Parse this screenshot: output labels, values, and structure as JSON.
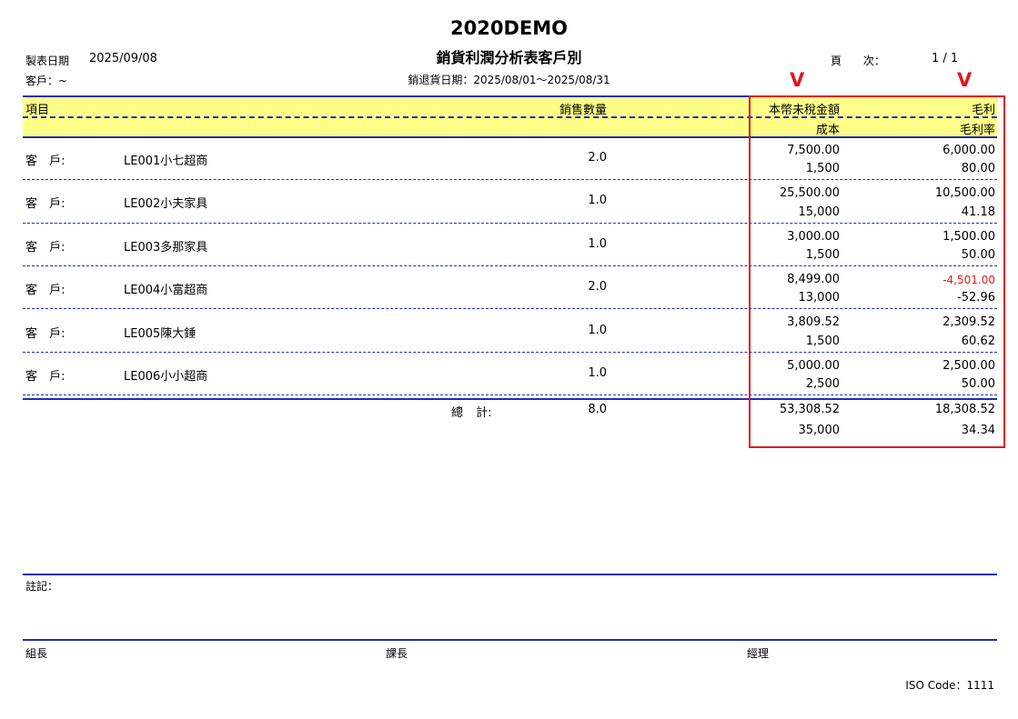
{
  "header": {
    "company": "2020DEMO",
    "report_title": "銷貨利潤分析表客戶別",
    "print_date_label": "製表日期",
    "print_date": "2025/09/08",
    "customer_filter": "客戶：~",
    "period": "銷退貨日期：2025/08/01～2025/08/31",
    "page_label": "頁 次：",
    "page_number": "1 / 1"
  },
  "columns": {
    "item": "項目",
    "qty": "銷售數量",
    "amount": "本幣未稅金額",
    "profit": "毛利",
    "cost": "成本",
    "margin": "毛利率"
  },
  "rows": [
    {
      "label": "客 戶:",
      "name": "LE001小七超商",
      "qty": "2.0",
      "amount": "7,500.00",
      "cost": "1,500",
      "profit": "6,000.00",
      "margin": "80.00"
    },
    {
      "label": "客 戶:",
      "name": "LE002小夫家具",
      "qty": "1.0",
      "amount": "25,500.00",
      "cost": "15,000",
      "profit": "10,500.00",
      "margin": "41.18"
    },
    {
      "label": "客 戶:",
      "name": "LE003多那家具",
      "qty": "1.0",
      "amount": "3,000.00",
      "cost": "1,500",
      "profit": "1,500.00",
      "margin": "50.00"
    },
    {
      "label": "客 戶:",
      "name": "LE004小富超商",
      "qty": "2.0",
      "amount": "8,499.00",
      "cost": "13,000",
      "profit": "-4,501.00",
      "margin": "-52.96"
    },
    {
      "label": "客 戶:",
      "name": "LE005陳大錘",
      "qty": "1.0",
      "amount": "3,809.52",
      "cost": "1,500",
      "profit": "2,309.52",
      "margin": "60.62"
    },
    {
      "label": "客 戶:",
      "name": "LE006小小超商",
      "qty": "1.0",
      "amount": "5,000.00",
      "cost": "2,500",
      "profit": "2,500.00",
      "margin": "50.00"
    }
  ],
  "total": {
    "label": "總 計:",
    "qty": "8.0",
    "amount": "53,308.52",
    "cost": "35,000",
    "profit": "18,308.52",
    "margin": "34.34"
  },
  "annotation": {
    "mark": "V",
    "color": "#e0161e"
  },
  "footer": {
    "notes_label": "註記：",
    "sign_1": "組長",
    "sign_2": "課長",
    "sign_3": "經理",
    "iso": "ISO Code：1111"
  }
}
